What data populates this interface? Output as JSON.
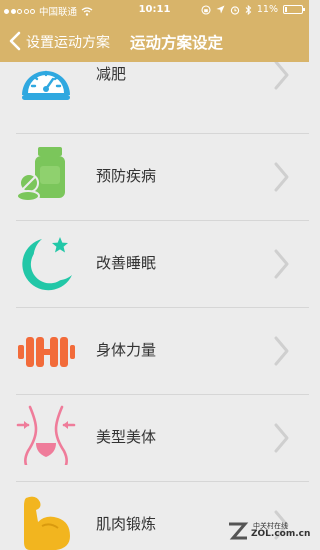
{
  "status_bar": {
    "carrier": "中国联通",
    "time": "10:11",
    "battery": "11%",
    "battery_level": 0.11
  },
  "nav": {
    "back_label": "设置运动方案",
    "title": "运动方案设定"
  },
  "items": [
    {
      "label": "减肥",
      "icon": "speedometer-icon"
    },
    {
      "label": "预防疾病",
      "icon": "medicine-bottle-icon"
    },
    {
      "label": "改善睡眠",
      "icon": "moon-star-icon"
    },
    {
      "label": "身体力量",
      "icon": "dumbbell-icon"
    },
    {
      "label": "美型美体",
      "icon": "body-shape-icon"
    },
    {
      "label": "肌肉锻炼",
      "icon": "flexed-arm-icon"
    }
  ],
  "watermark": {
    "line1": "中关村在线",
    "line2": "ZOL.com.cn"
  },
  "colors": {
    "header": "#d8b46a",
    "blue_icon": "#2fa8e0",
    "green_icon": "#7bc65b",
    "teal_icon": "#22c7a7",
    "orange_icon": "#f26b3a",
    "pink_icon": "#ef7c9a",
    "yellow_icon": "#f2b51f"
  }
}
